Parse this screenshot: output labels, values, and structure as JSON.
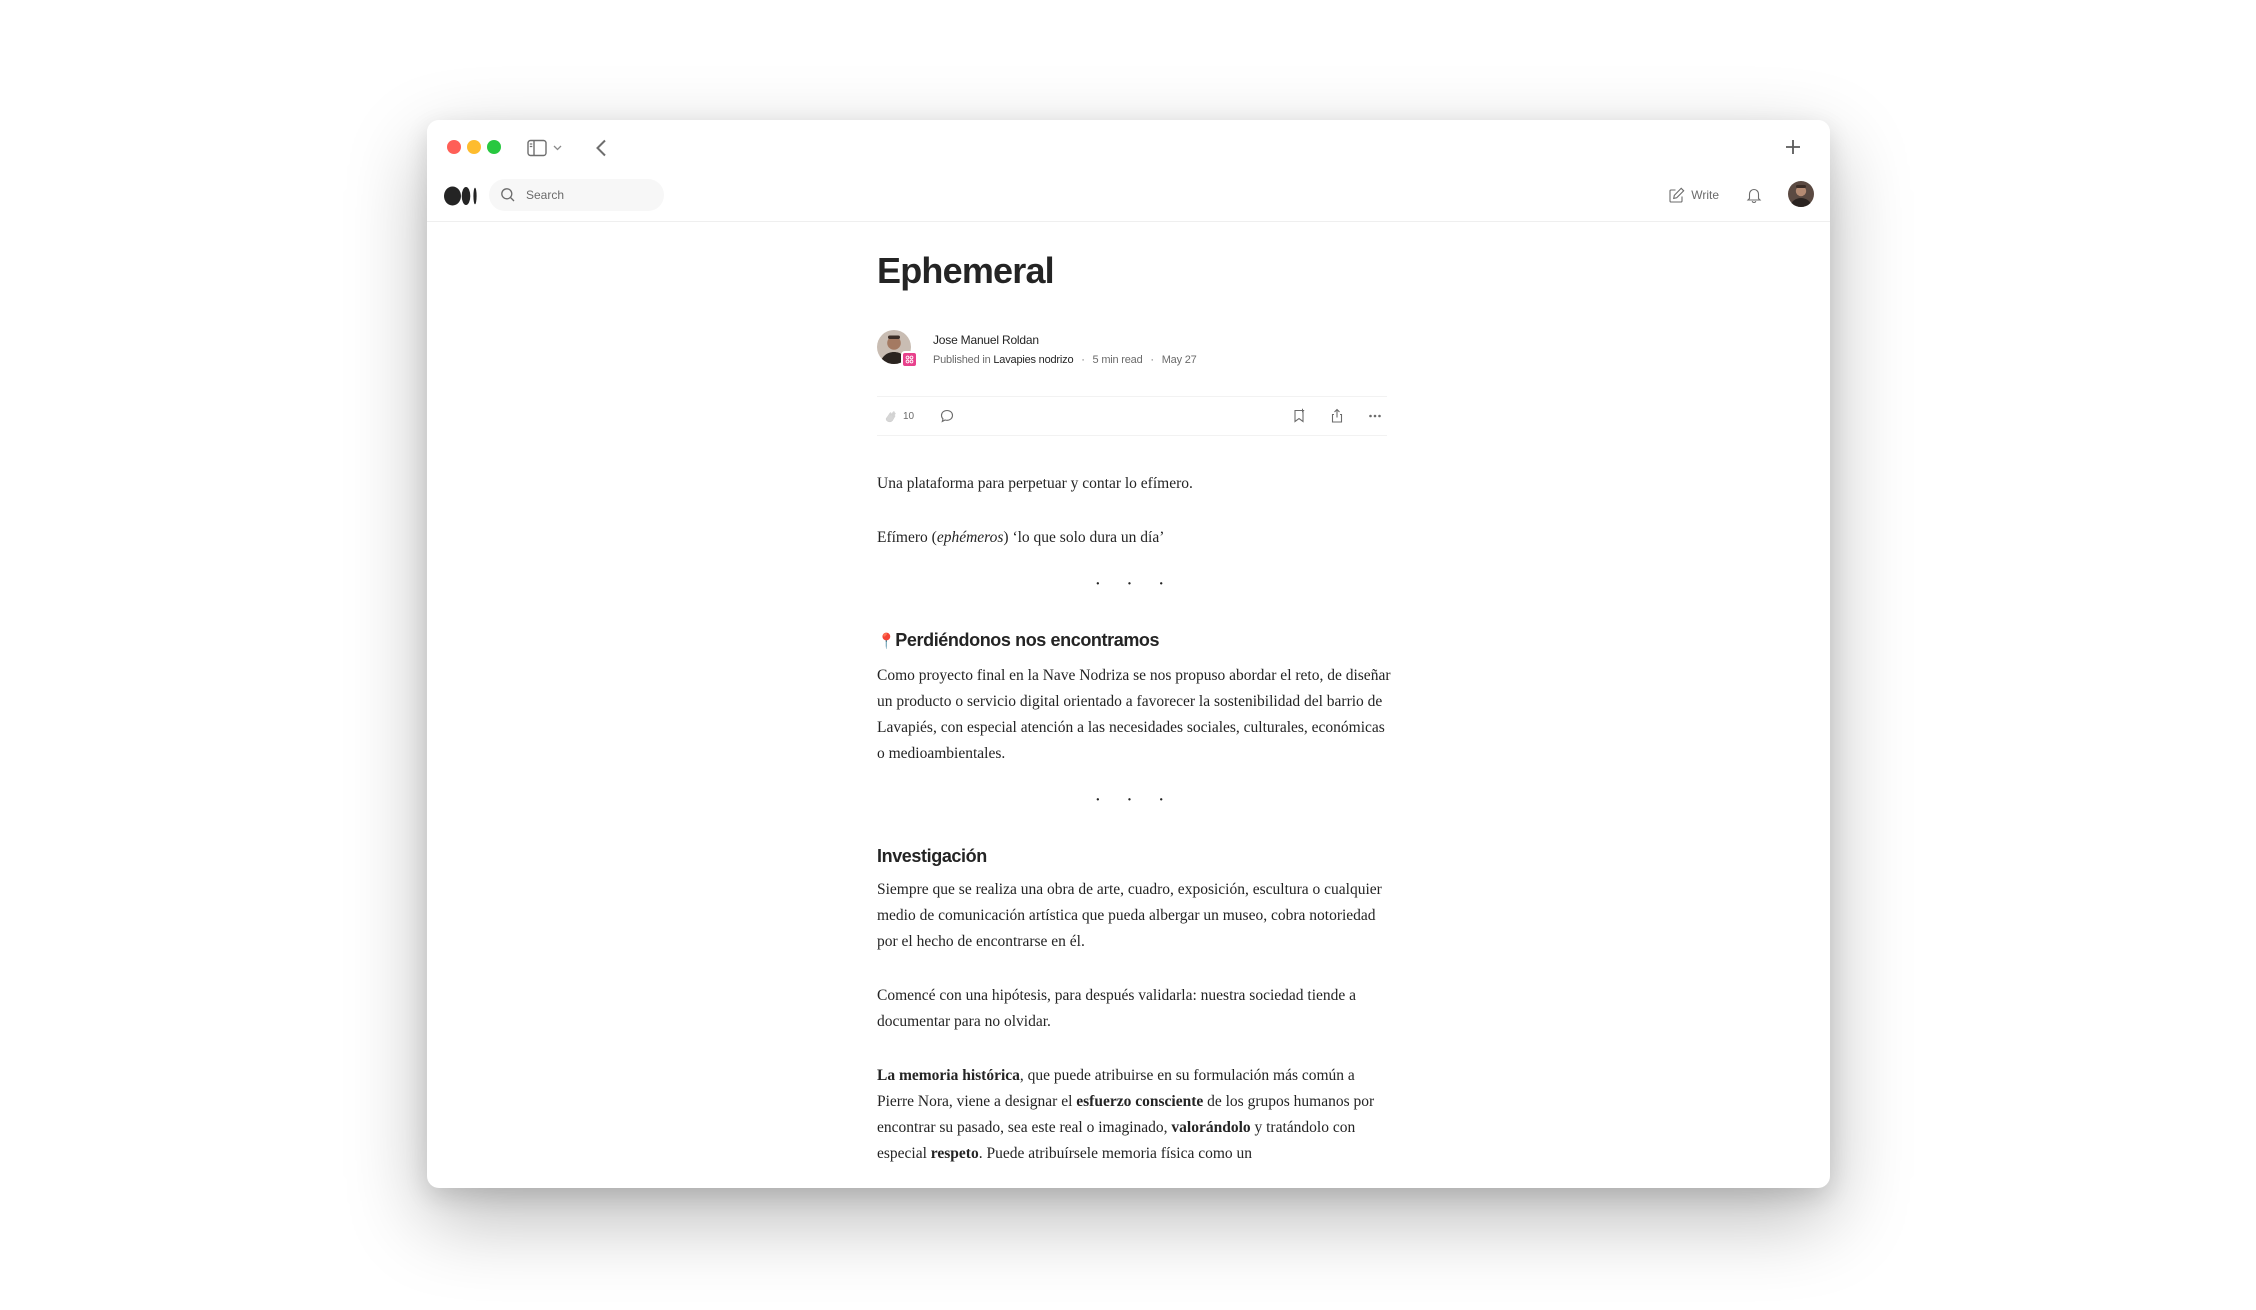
{
  "browser": {
    "lights": {
      "close": "#ff5f57",
      "minimize": "#febc2e",
      "maximize": "#28c840"
    }
  },
  "nav": {
    "search_placeholder": "Search",
    "write_label": "Write"
  },
  "article": {
    "title": "Ephemeral",
    "author": "Jose Manuel Roldan",
    "published_in_prefix": "Published in",
    "publication": "Lavapies nodrizo",
    "read_time": "5 min read",
    "date": "May 27",
    "clap_count": "10",
    "separator": "· · ·",
    "intro": "Una plataforma para perpetuar y contar lo efímero.",
    "definition": {
      "before": "Efímero (",
      "italic": "ephémeros",
      "after": ") ‘lo que solo dura un día’"
    },
    "section1": {
      "pin": "📍",
      "heading": "Perdiéndonos nos encontramos",
      "paragraph": "Como proyecto final en la Nave Nodriza se nos propuso abordar el reto, de diseñar un producto o servicio digital orientado a favorecer la sostenibilidad del barrio de Lavapiés, con especial atención a las necesidades sociales, culturales, económicas o medioambientales."
    },
    "section2": {
      "heading": "Investigación",
      "paragraph1": "Siempre que se realiza una obra de arte, cuadro, exposición, escultura o cualquier medio de comunicación artística que pueda albergar un museo, cobra notoriedad por el hecho de encontrarse en él.",
      "paragraph2": "Comencé con una hipótesis, para después validarla: nuestra sociedad tiende a documentar para no olvidar.",
      "paragraph3": {
        "b1": "La memoria histórica",
        "t1": ", que puede atribuirse en su formulación más común a Pierre Nora, viene a designar el ",
        "b2": "esfuerzo consciente",
        "t2": " de los grupos humanos por encontrar su pasado, sea este real o imaginado, ",
        "b3": "valorándolo",
        "t3": " y tratándolo con especial ",
        "b4": "respeto",
        "t4": ". Puede atribuírsele memoria física como un"
      }
    }
  }
}
